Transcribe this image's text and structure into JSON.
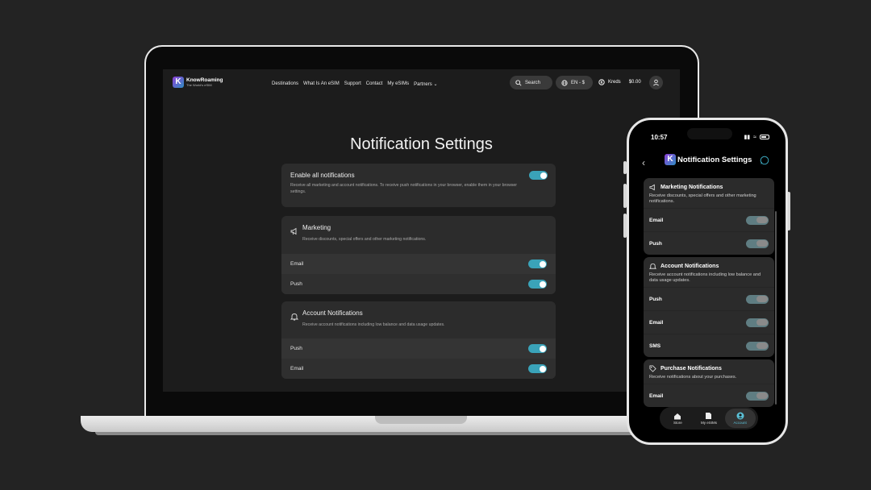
{
  "web": {
    "brand": {
      "name": "KnowRoaming",
      "tagline": "The World's eSIM",
      "logo_letter": "K"
    },
    "nav_links": [
      "Destinations",
      "What Is An eSIM",
      "Support",
      "Contact",
      "My eSIMs",
      "Partners"
    ],
    "search_label": "Search",
    "language_label": "EN - $",
    "kreds_label": "Kreds",
    "kreds_amount": "$0.00",
    "page_title": "Notification Settings",
    "enable_all": {
      "title": "Enable all notifications",
      "desc": "Receive all marketing and account notifications. To receive push notifications in your browser, enable them in your browser settings."
    },
    "marketing": {
      "title": "Marketing",
      "desc": "Receive discounts, special offers and other marketing notifications.",
      "rows": [
        "Email",
        "Push"
      ]
    },
    "account": {
      "title": "Account Notifications",
      "desc": "Receive account notifications including low balance and data usage updates.",
      "rows": [
        "Push",
        "Email"
      ]
    }
  },
  "phone": {
    "time": "10:57",
    "title": "Notification Settings",
    "marketing": {
      "title": "Marketing Notifications",
      "desc": "Receive discounts, special offers and other marketing notifications.",
      "rows": [
        "Email",
        "Push"
      ]
    },
    "account": {
      "title": "Account Notifications",
      "desc": "Receive account notifications including low balance and data usage updates.",
      "rows": [
        "Push",
        "Email",
        "SMS"
      ]
    },
    "purchase": {
      "title": "Purchase Notifications",
      "desc": "Receive notifications about your purchases.",
      "rows": [
        "Email"
      ]
    },
    "tabs": [
      "Store",
      "My eSIMs",
      "Account"
    ]
  },
  "colors": {
    "toggle_on": "#3aa3b9",
    "accent_tab": "#5bc0d6",
    "brand_purple": "#8e3fd6"
  }
}
